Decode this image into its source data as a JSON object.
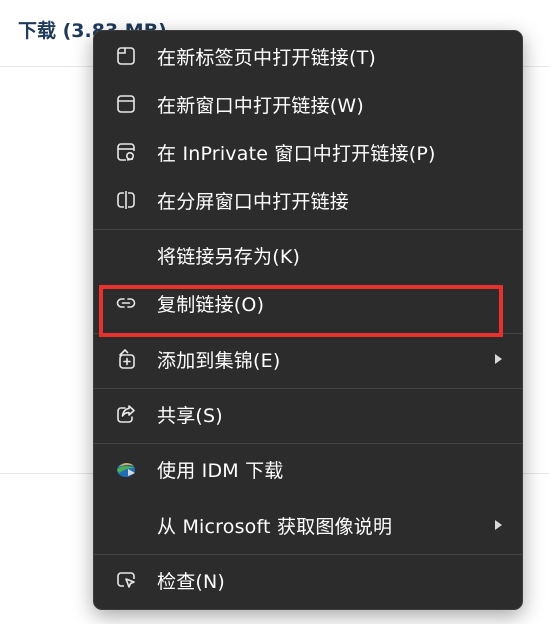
{
  "background": {
    "title": "下载 (3.83 MB)"
  },
  "menu": {
    "items": [
      {
        "label": "在新标签页中打开链接(T)",
        "icon": "new-tab-icon"
      },
      {
        "label": "在新窗口中打开链接(W)",
        "icon": "new-window-icon"
      },
      {
        "label": "在 InPrivate 窗口中打开链接(P)",
        "icon": "inprivate-window-icon"
      },
      {
        "label": "在分屏窗口中打开链接",
        "icon": "split-screen-icon"
      },
      {
        "label": "将链接另存为(K)",
        "icon": ""
      },
      {
        "label": "复制链接(O)",
        "icon": "link-icon"
      },
      {
        "label": "添加到集锦(E)",
        "icon": "collections-icon",
        "submenu": true
      },
      {
        "label": "共享(S)",
        "icon": "share-icon"
      },
      {
        "label": "使用 IDM 下载",
        "icon": "idm-icon"
      },
      {
        "label": "从 Microsoft 获取图像说明",
        "icon": "",
        "submenu": true
      },
      {
        "label": "检查(N)",
        "icon": "inspect-icon"
      }
    ]
  },
  "colors": {
    "menu_bg": "#2c2c2c",
    "text": "#ffffff",
    "highlight_border": "#e8312f"
  }
}
